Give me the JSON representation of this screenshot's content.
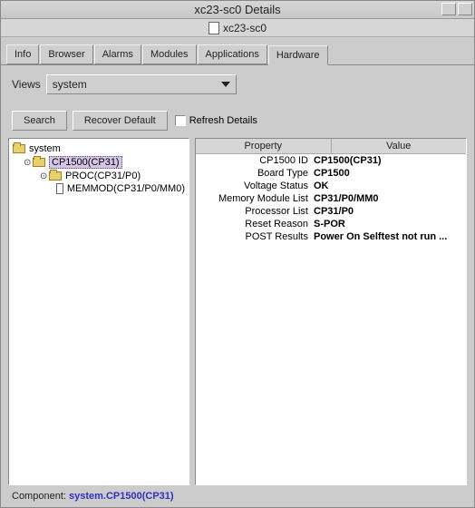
{
  "window": {
    "title": "xc23-sc0 Details",
    "subtitle": "xc23-sc0"
  },
  "tabs": [
    {
      "label": "Info"
    },
    {
      "label": "Browser"
    },
    {
      "label": "Alarms"
    },
    {
      "label": "Modules"
    },
    {
      "label": "Applications"
    },
    {
      "label": "Hardware"
    }
  ],
  "active_tab_index": 5,
  "views": {
    "label": "Views",
    "selected": "system"
  },
  "toolbar": {
    "search_label": "Search",
    "recover_default_label": "Recover Default",
    "refresh_label": "Refresh Details",
    "refresh_checked": false
  },
  "tree": {
    "0": {
      "label": "system"
    },
    "1": {
      "label": "CP1500(CP31)"
    },
    "2": {
      "label": "PROC(CP31/P0)"
    },
    "3": {
      "label": "MEMMOD(CP31/P0/MM0)"
    }
  },
  "detail_header": {
    "property": "Property",
    "value": "Value"
  },
  "details": [
    {
      "key": "CP1500 ID",
      "value": "CP1500(CP31)"
    },
    {
      "key": "Board Type",
      "value": "CP1500"
    },
    {
      "key": "Voltage Status",
      "value": "OK"
    },
    {
      "key": "Memory Module List",
      "value": "CP31/P0/MM0"
    },
    {
      "key": "Processor List",
      "value": "CP31/P0"
    },
    {
      "key": "Reset Reason",
      "value": "S-POR"
    },
    {
      "key": "POST Results",
      "value": "Power On Selftest not run ..."
    }
  ],
  "footer": {
    "label": "Component:",
    "path": "system.CP1500(CP31)"
  }
}
